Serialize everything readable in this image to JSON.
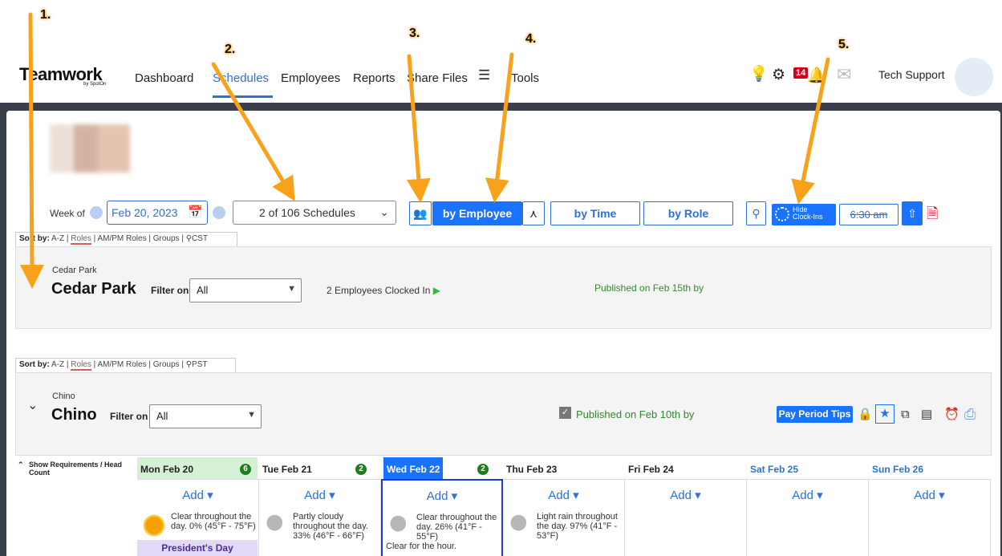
{
  "app": {
    "logo": "Teamwork",
    "logo_sub": "by SpotOn"
  },
  "nav": {
    "items": [
      "Dashboard",
      "Schedules",
      "Employees",
      "Reports",
      "Share Files",
      "Tools"
    ],
    "active": "Schedules"
  },
  "header": {
    "notifications_count": "14",
    "user_name": "Tech Support"
  },
  "toolbar": {
    "week_label": "Week of",
    "week_date": "Feb 20, 2023",
    "schedule_select": "2 of 106 Schedules",
    "by_employee": "by Employee",
    "by_time": "by Time",
    "by_role": "by Role",
    "hide_clockins": "Hide\nClock-Ins",
    "time_value": "6:30 am"
  },
  "sections": [
    {
      "sort": {
        "label": "Sort by:",
        "az": "A-Z",
        "roles": "Roles",
        "ampm": "AM/PM Roles",
        "groups": "Groups",
        "tz": "CST"
      },
      "location_small": "Cedar Park",
      "location_big": "Cedar Park",
      "filter_label": "Filter on",
      "filter_value": "All",
      "clocked_in": "2 Employees Clocked In",
      "published": "Published on Feb 15th by"
    },
    {
      "sort": {
        "label": "Sort by:",
        "az": "A-Z",
        "roles": "Roles",
        "ampm": "AM/PM Roles",
        "groups": "Groups",
        "tz": "PST"
      },
      "location_small": "Chino",
      "location_big": "Chino",
      "filter_label": "Filter on",
      "filter_value": "All",
      "published": "Published on Feb 10th by",
      "pay_period_tips": "Pay Period Tips"
    }
  ],
  "calendar": {
    "requirements": "Show Requirements / Head Count",
    "add_label": "Add",
    "days": [
      {
        "label": "Mon Feb 20",
        "badge": "6",
        "weather": "Clear throughout the day. 0% (45°F - 75°F)",
        "extra": "",
        "holiday": "President's Day"
      },
      {
        "label": "Tue Feb 21",
        "badge": "2",
        "weather": "Partly cloudy throughout the day. 33% (46°F - 66°F)",
        "extra": ""
      },
      {
        "label": "Wed Feb 22",
        "badge": "2",
        "weather": "Clear throughout the day. 26% (41°F - 55°F)",
        "extra": "Clear for the hour."
      },
      {
        "label": "Thu Feb 23",
        "badge": "",
        "weather": "Light rain throughout the day. 97% (41°F - 53°F)",
        "extra": ""
      },
      {
        "label": "Fri Feb 24",
        "badge": "",
        "weather": "",
        "extra": ""
      },
      {
        "label": "Sat Feb 25",
        "badge": "",
        "weather": "",
        "extra": ""
      },
      {
        "label": "Sun Feb 26",
        "badge": "",
        "weather": "",
        "extra": ""
      }
    ]
  },
  "annotations": [
    "1.",
    "2.",
    "3.",
    "4.",
    "5."
  ],
  "colors": {
    "accent": "#1a73ff",
    "arrow": "#f7a21a",
    "published": "#2e8b2e"
  }
}
